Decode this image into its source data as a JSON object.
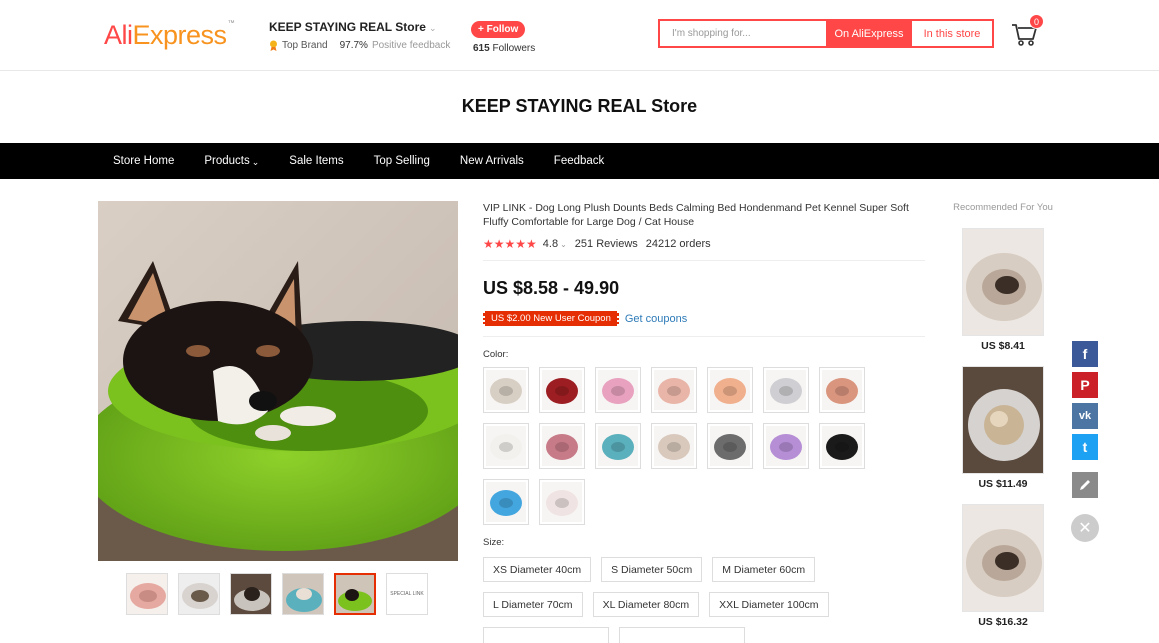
{
  "header": {
    "logo_ali": "Ali",
    "logo_express": "Express",
    "logo_tm": "™",
    "store_name": "KEEP STAYING REAL Store",
    "top_brand": "Top Brand",
    "positive_pct": "97.7%",
    "positive_label": "Positive feedback",
    "follow_label": "+ Follow",
    "followers_count": "615",
    "followers_label": "Followers",
    "search_placeholder": "I'm shopping for...",
    "search_on_ali": "On AliExpress",
    "search_in_store": "In this store",
    "cart_count": "0"
  },
  "store_title": "KEEP STAYING REAL Store",
  "nav": {
    "items": [
      "Store Home",
      "Products",
      "Sale Items",
      "Top Selling",
      "New Arrivals",
      "Feedback"
    ]
  },
  "product": {
    "title": "VIP LINK - Dog Long Plush Dounts Beds Calming Bed Hondenmand Pet Kennel Super Soft Fluffy Comfortable for Large Dog / Cat House",
    "stars": "★★★★★",
    "rating": "4.8",
    "reviews": "251 Reviews",
    "orders": "24212 orders",
    "price": "US $8.58 - 49.90",
    "coupon": "US $2.00 New User Coupon",
    "get_coupons": "Get coupons",
    "color_label": "Color:",
    "colors": [
      "#d8cfc4",
      "#9c1e22",
      "#e8a2bf",
      "#e9b5a8",
      "#f0b08e",
      "#cfcfd3",
      "#d9957e",
      "#f3f1ee",
      "#c77b88",
      "#5ab0bc",
      "#d9c9bd",
      "#6c6c6c",
      "#b68ed6",
      "#1a1a1a",
      "#44a6df",
      "#efe3e3"
    ],
    "size_label": "Size:",
    "sizes": [
      "XS Diameter 40cm",
      "S Diameter 50cm",
      "M Diameter 60cm",
      "L Diameter 70cm",
      "XL Diameter 80cm",
      "XXL Diameter 100cm"
    ],
    "thumb_special": "SPECIAL LINK"
  },
  "recommended": {
    "title": "Recommended For You",
    "items": [
      {
        "price": "US $8.41"
      },
      {
        "price": "US $11.49"
      },
      {
        "price": "US $16.32"
      }
    ]
  },
  "share": {
    "facebook": "f",
    "pinterest": "P",
    "vk": "vk",
    "twitter": "t"
  }
}
